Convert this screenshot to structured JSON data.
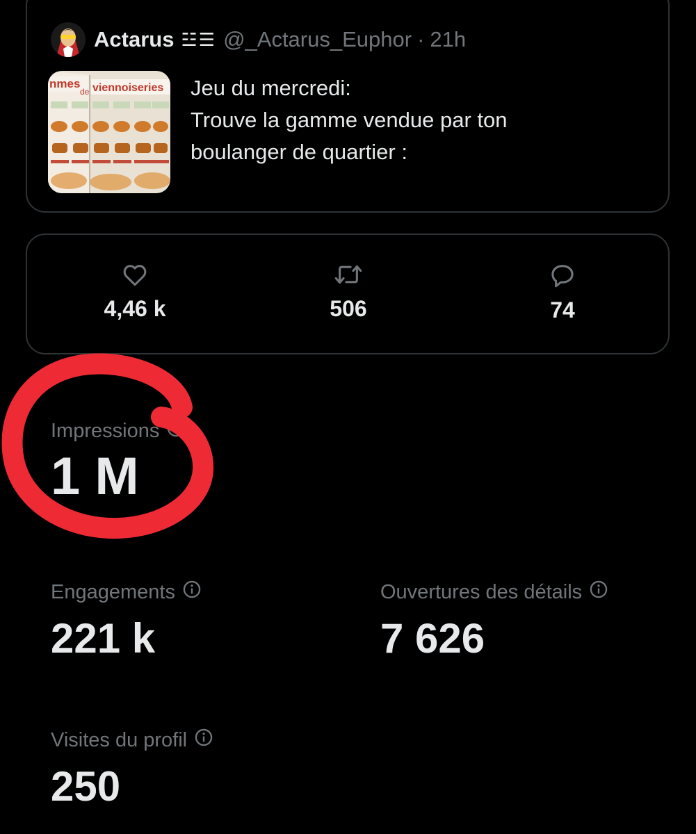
{
  "tweet": {
    "author_name": "Actarus",
    "author_badge": "☳☰",
    "author_handle": "@_Actarus_Euphor",
    "separator": "·",
    "time": "21h",
    "text_lines": [
      "Jeu du mercredi:",
      "Trouve la gamme vendue par ton",
      "boulanger de quartier :"
    ],
    "thumbnail_words": [
      "nmes",
      "de",
      "viennoiseries"
    ]
  },
  "stats": {
    "likes": "4,46 k",
    "retweets": "506",
    "replies": "74"
  },
  "metrics": {
    "impressions_label": "Impressions",
    "impressions_value": "1 M",
    "engagements_label": "Engagements",
    "engagements_value": "221 k",
    "detail_opens_label": "Ouvertures des détails",
    "detail_opens_value": "7 626",
    "profile_visits_label": "Visites du profil",
    "profile_visits_value": "250"
  },
  "annotation": {
    "scribble_color": "#ee2b34"
  },
  "colors": {
    "background": "#000000",
    "text_primary": "#e7e9ea",
    "text_secondary": "#71767b",
    "border": "#2f3336"
  },
  "icons": {
    "like": "heart-icon",
    "retweet": "retweet-icon",
    "reply": "reply-icon",
    "info": "info-icon"
  }
}
